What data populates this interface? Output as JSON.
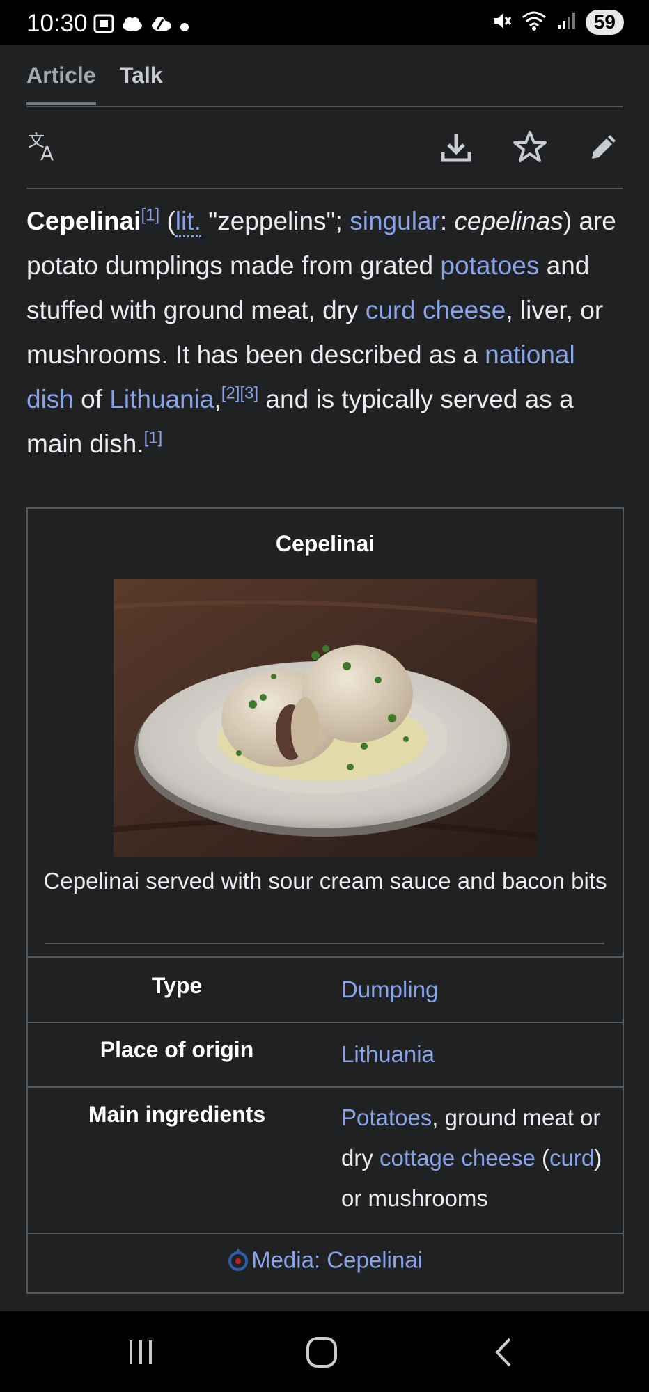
{
  "status": {
    "time": "10:30",
    "battery": "59",
    "left_icons": [
      "screenshot-icon",
      "cloud-icon",
      "weather-icon",
      "dot-icon"
    ],
    "right_icons": [
      "mute-icon",
      "wifi-icon",
      "signal-icon"
    ]
  },
  "tabs": {
    "article": "Article",
    "talk": "Talk"
  },
  "toolbar": {
    "icons": [
      "language-icon",
      "download-icon",
      "star-icon",
      "edit-icon"
    ]
  },
  "lead": {
    "term": "Cepelinai",
    "ref1": "[1]",
    "paren_open": " (",
    "lit": "lit.",
    "zeppelins": " \"zeppelins\"; ",
    "singular": "singular",
    "colon": ": ",
    "singular_form": "cepelinas",
    "line1_end": ")",
    "text1": " are potato dumplings made from grated ",
    "potatoes": "potatoes",
    "text2": " and stuffed with ground meat, dry ",
    "curd_cheese": "curd cheese",
    "text3": ", liver, or mushrooms. It has been described as a ",
    "national_dish": "national dish",
    "of": " of ",
    "lithuania": "Lithuania",
    "comma": ",",
    "ref23": "[2][3]",
    "text4": " and is typically served as a main dish.",
    "ref1b": "[1]"
  },
  "infobox": {
    "title": "Cepelinai",
    "caption": "Cepelinai served with sour cream sauce and bacon bits",
    "rows": [
      {
        "label": "Type",
        "value_link": "Dumpling"
      },
      {
        "label": "Place of origin",
        "value_link": "Lithuania"
      },
      {
        "label": "Main ingredients",
        "potatoes": "Potatoes",
        "t1": ", ground meat or dry ",
        "cottage": "cottage cheese",
        "t2": " (",
        "curd": "curd",
        "t3": ") or mushrooms"
      }
    ],
    "media": "Media: Cepelinai"
  },
  "nav": {
    "icons": [
      "recents-icon",
      "home-icon",
      "back-icon"
    ]
  },
  "colors": {
    "background": "#202122",
    "link": "#88a3e8",
    "border": "#54595d"
  }
}
